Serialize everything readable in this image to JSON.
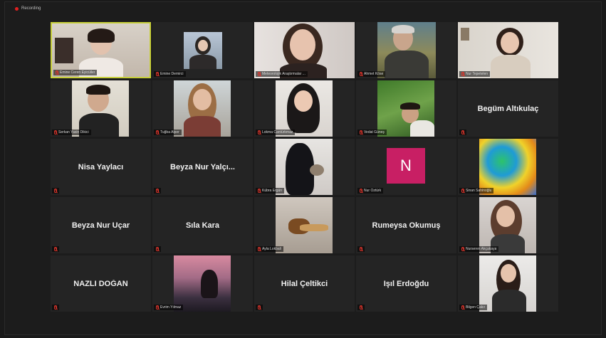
{
  "recording": {
    "label": "Recording"
  },
  "colors": {
    "active_border": "#c7cf3a",
    "muted_mic": "#d9342b",
    "recording_dot": "#e02020",
    "avatar_n": "#c81f64"
  },
  "participants": [
    {
      "caption": "Emine Ceren Eyicüller",
      "video": true,
      "active": true
    },
    {
      "caption": "Emine Demirci",
      "video": true
    },
    {
      "caption": "Meteorolojik Araştırmalar ...",
      "video": true
    },
    {
      "caption": "Ahmet Köse",
      "video": true
    },
    {
      "caption": "Nur Tepetelen",
      "video": true
    },
    {
      "caption": "Serkan Yasin Dikici",
      "video": true
    },
    {
      "caption": "Tuğba Alper",
      "video": true
    },
    {
      "caption": "Lokma Cantürkmaz",
      "video": true
    },
    {
      "caption": "Vedat Güneş",
      "video": true
    },
    {
      "display_name": "Begüm Altıkulaç",
      "video": false
    },
    {
      "display_name": "Nisa Yaylacı",
      "video": false
    },
    {
      "display_name": "Beyza Nur Yalçı...",
      "video": false
    },
    {
      "caption": "Kübra Ergün",
      "video": true
    },
    {
      "caption": "Nur Öztürk",
      "avatar_letter": "N",
      "video": false
    },
    {
      "caption": "Sinan Sahinoğlu",
      "video": true
    },
    {
      "display_name": "Beyza Nur Uçar",
      "video": false
    },
    {
      "display_name": "Sıla Kara",
      "video": false
    },
    {
      "caption": "Ayla Lokbali",
      "video": true
    },
    {
      "display_name": "Rumeysa Okumuş",
      "video": false
    },
    {
      "caption": "Nurseren Akçakaya",
      "video": true
    },
    {
      "display_name": "NAZLI DOĞAN",
      "video": false
    },
    {
      "caption": "Evrim Yılmaz",
      "video": true
    },
    {
      "display_name": "Hilal Çeltikci",
      "video": false
    },
    {
      "display_name": "Işıl Erdoğdu",
      "video": false
    },
    {
      "caption": "Bilgen Çakır",
      "video": true
    }
  ]
}
